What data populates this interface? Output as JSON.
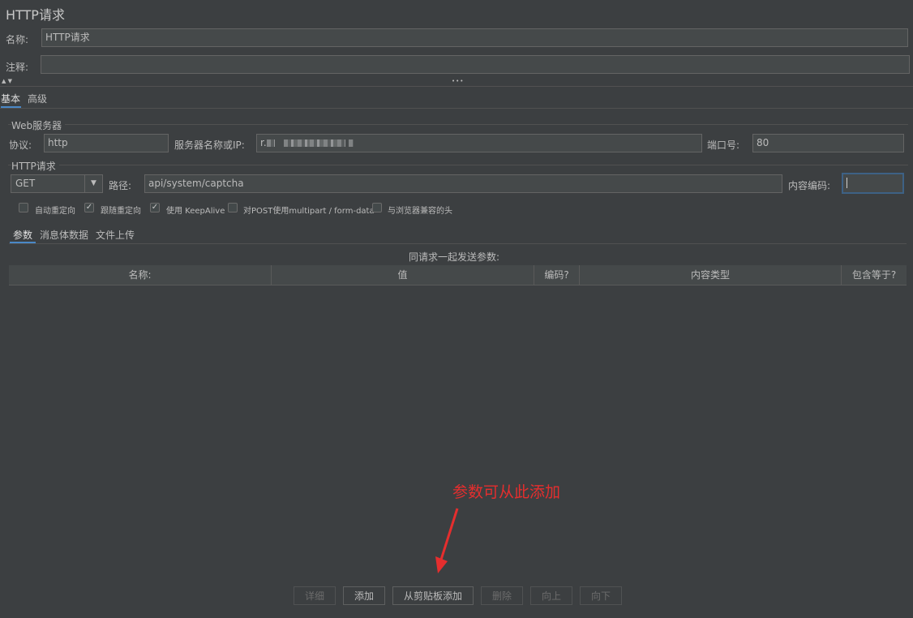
{
  "header": {
    "title": "HTTP请求"
  },
  "form": {
    "name_label": "名称:",
    "name_value": "HTTP请求",
    "comment_label": "注释:",
    "comment_value": ""
  },
  "splitter": {
    "arrows": "▲ ▼",
    "dots": "•••"
  },
  "tabs": [
    "基本",
    "高级"
  ],
  "web_server": {
    "group_title": "Web服务器",
    "protocol_label": "协议:",
    "protocol_value": "http",
    "server_label": "服务器名称或IP:",
    "server_value_prefix": "r.",
    "port_label": "端口号:",
    "port_value": "80"
  },
  "http_request": {
    "group_title": "HTTP请求",
    "method": "GET",
    "path_label": "路径:",
    "path_value": "api/system/captcha",
    "encoding_label": "内容编码:",
    "encoding_value": ""
  },
  "options": [
    {
      "label": "自动重定向",
      "checked": false
    },
    {
      "label": "跟随重定向",
      "checked": true
    },
    {
      "label": "使用 KeepAlive",
      "checked": true
    },
    {
      "label": "对POST使用multipart / form-data",
      "checked": false
    },
    {
      "label": "与浏览器兼容的头",
      "checked": false
    }
  ],
  "sub_tabs": [
    "参数",
    "消息体数据",
    "文件上传"
  ],
  "params": {
    "caption": "同请求一起发送参数:",
    "columns": [
      "名称:",
      "值",
      "编码?",
      "内容类型",
      "包含等于?"
    ]
  },
  "buttons": {
    "detail": "详细",
    "add": "添加",
    "add_clipboard": "从剪贴板添加",
    "delete": "删除",
    "up": "向上",
    "down": "向下"
  },
  "annotation": {
    "text": "参数可从此添加",
    "color": "#e52e2e"
  }
}
